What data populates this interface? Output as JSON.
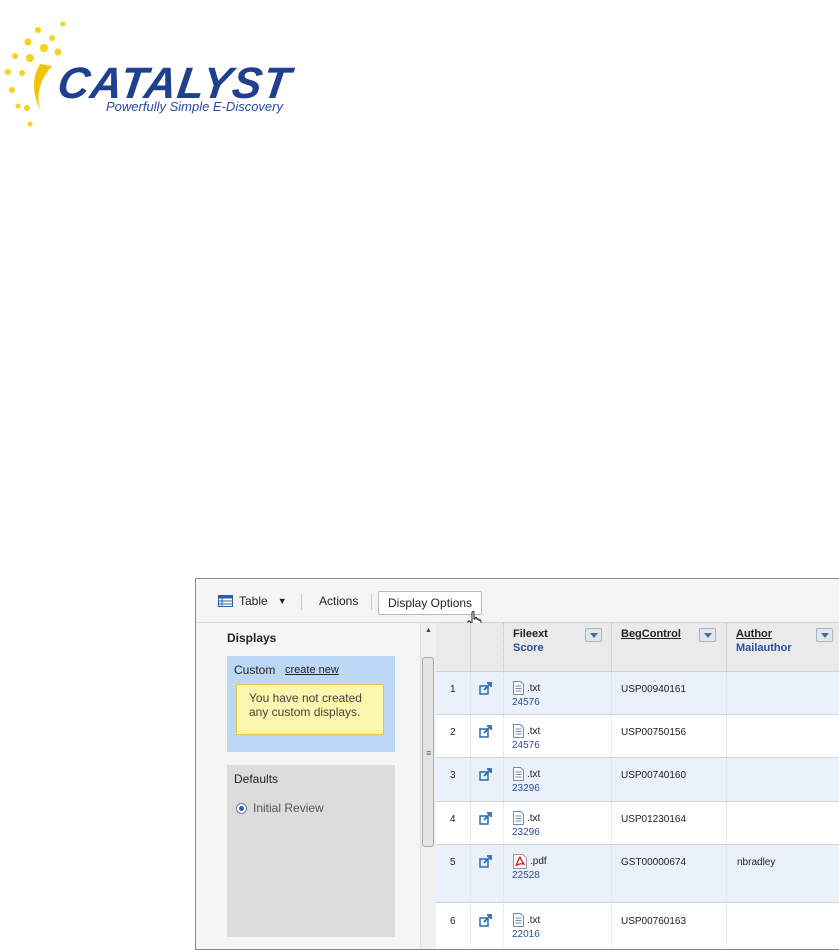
{
  "logo": {
    "wordmark": "CATALYST",
    "tagline": "Powerfully Simple E-Discovery",
    "brand_color": "#1f3f8f",
    "accent_color": "#f7d21a"
  },
  "toolbar": {
    "view_label": "Table",
    "actions_label": "Actions",
    "display_options_label": "Display Options"
  },
  "left_panel": {
    "title": "Displays",
    "custom": {
      "label": "Custom",
      "create_link": "create new",
      "empty_message_line1": "You have not created",
      "empty_message_line2": "any custom displays."
    },
    "defaults": {
      "label": "Defaults",
      "selected_option": "Initial Review"
    }
  },
  "table": {
    "columns": [
      {
        "primary": "Fileext",
        "secondary": "Score"
      },
      {
        "primary": "BegControl",
        "secondary": ""
      },
      {
        "primary": "Author",
        "secondary": "Mailauthor"
      }
    ],
    "rows": [
      {
        "num": "1",
        "fileext": ".txt",
        "score": "24576",
        "begcontrol": "USP00940161",
        "author": "",
        "icon": "text-file-icon"
      },
      {
        "num": "2",
        "fileext": ".txt",
        "score": "24576",
        "begcontrol": "USP00750156",
        "author": "",
        "icon": "text-file-icon"
      },
      {
        "num": "3",
        "fileext": ".txt",
        "score": "23296",
        "begcontrol": "USP00740160",
        "author": "",
        "icon": "text-file-icon"
      },
      {
        "num": "4",
        "fileext": ".txt",
        "score": "23296",
        "begcontrol": "USP01230164",
        "author": "",
        "icon": "text-file-icon"
      },
      {
        "num": "5",
        "fileext": ".pdf",
        "score": "22528",
        "begcontrol": "GST00000674",
        "author": "nbradley",
        "icon": "pdf-file-icon"
      },
      {
        "num": "6",
        "fileext": ".txt",
        "score": "22016",
        "begcontrol": "USP00760163",
        "author": "",
        "icon": "text-file-icon"
      }
    ]
  }
}
